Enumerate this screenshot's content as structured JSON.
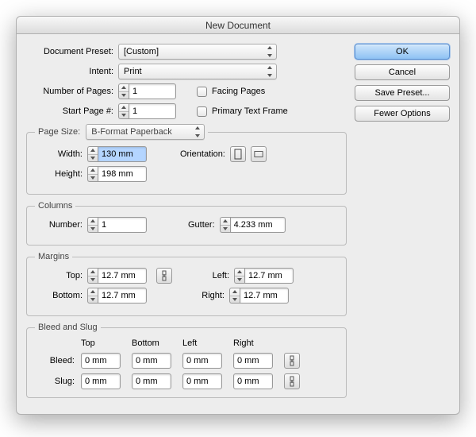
{
  "title": "New Document",
  "buttons": {
    "ok": "OK",
    "cancel": "Cancel",
    "save_preset": "Save Preset...",
    "fewer_options": "Fewer Options"
  },
  "preset": {
    "label": "Document Preset:",
    "value": "[Custom]"
  },
  "intent": {
    "label": "Intent:",
    "value": "Print"
  },
  "pages": {
    "number_label": "Number of Pages:",
    "number_value": "1",
    "start_label": "Start Page #:",
    "start_value": "1",
    "facing_label": "Facing Pages",
    "primary_label": "Primary Text Frame"
  },
  "page_size": {
    "legend": "Page Size:",
    "value": "B-Format Paperback",
    "width_label": "Width:",
    "width_value": "130 mm",
    "height_label": "Height:",
    "height_value": "198 mm",
    "orientation_label": "Orientation:"
  },
  "columns": {
    "legend": "Columns",
    "number_label": "Number:",
    "number_value": "1",
    "gutter_label": "Gutter:",
    "gutter_value": "4.233 mm"
  },
  "margins": {
    "legend": "Margins",
    "top_label": "Top:",
    "top_value": "12.7 mm",
    "bottom_label": "Bottom:",
    "bottom_value": "12.7 mm",
    "left_label": "Left:",
    "left_value": "12.7 mm",
    "right_label": "Right:",
    "right_value": "12.7 mm"
  },
  "bleed_slug": {
    "legend": "Bleed and Slug",
    "col_top": "Top",
    "col_bottom": "Bottom",
    "col_left": "Left",
    "col_right": "Right",
    "bleed_label": "Bleed:",
    "slug_label": "Slug:",
    "bleed_top": "0 mm",
    "bleed_bottom": "0 mm",
    "bleed_left": "0 mm",
    "bleed_right": "0 mm",
    "slug_top": "0 mm",
    "slug_bottom": "0 mm",
    "slug_left": "0 mm",
    "slug_right": "0 mm"
  }
}
